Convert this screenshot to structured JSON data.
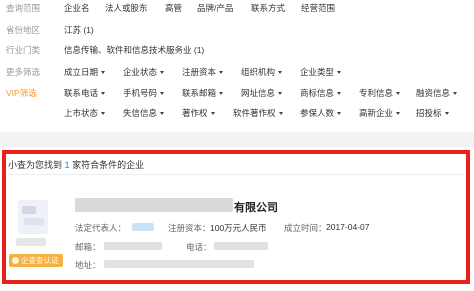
{
  "filters": {
    "search_scope": {
      "label": "查询范围",
      "options": [
        "企业名",
        "法人或股东",
        "高管",
        "品牌/产品",
        "联系方式",
        "经营范围"
      ]
    },
    "province": {
      "label": "省份地区",
      "value": "江苏 (1)"
    },
    "industry": {
      "label": "行业门类",
      "value": "信息传输、软件和信息技术服务业 (1)"
    },
    "more": {
      "label": "更多筛选",
      "options": [
        "成立日期",
        "企业状态",
        "注册资本",
        "组织机构",
        "企业类型"
      ]
    },
    "vip": {
      "label": "VIP筛选",
      "row1": [
        "联系电话",
        "手机号码",
        "联系邮箱",
        "网址信息",
        "商标信息",
        "专利信息",
        "融资信息"
      ],
      "row2": [
        "上市状态",
        "失信信息",
        "著作权",
        "软件著作权",
        "参保人数",
        "高新企业",
        "招投标"
      ]
    }
  },
  "results": {
    "summary_prefix": "小查为您找到",
    "summary_count": "1",
    "summary_suffix": "家符合条件的企业",
    "company": {
      "name_suffix": "有限公司",
      "legal_rep_label": "法定代表人：",
      "reg_capital_label": "注册资本：",
      "reg_capital_value": "100万元人民币",
      "founded_label": "成立时间：",
      "founded_value": "2017-04-07",
      "email_label": "邮箱：",
      "phone_label": "电话：",
      "address_label": "地址：",
      "cert_badge": "企查查认证"
    }
  },
  "colors": {
    "highlight_frame": "#e8211a",
    "accent_blue": "#128bed",
    "vip_orange": "#f39a33",
    "badge_gold": "#f6b143"
  }
}
